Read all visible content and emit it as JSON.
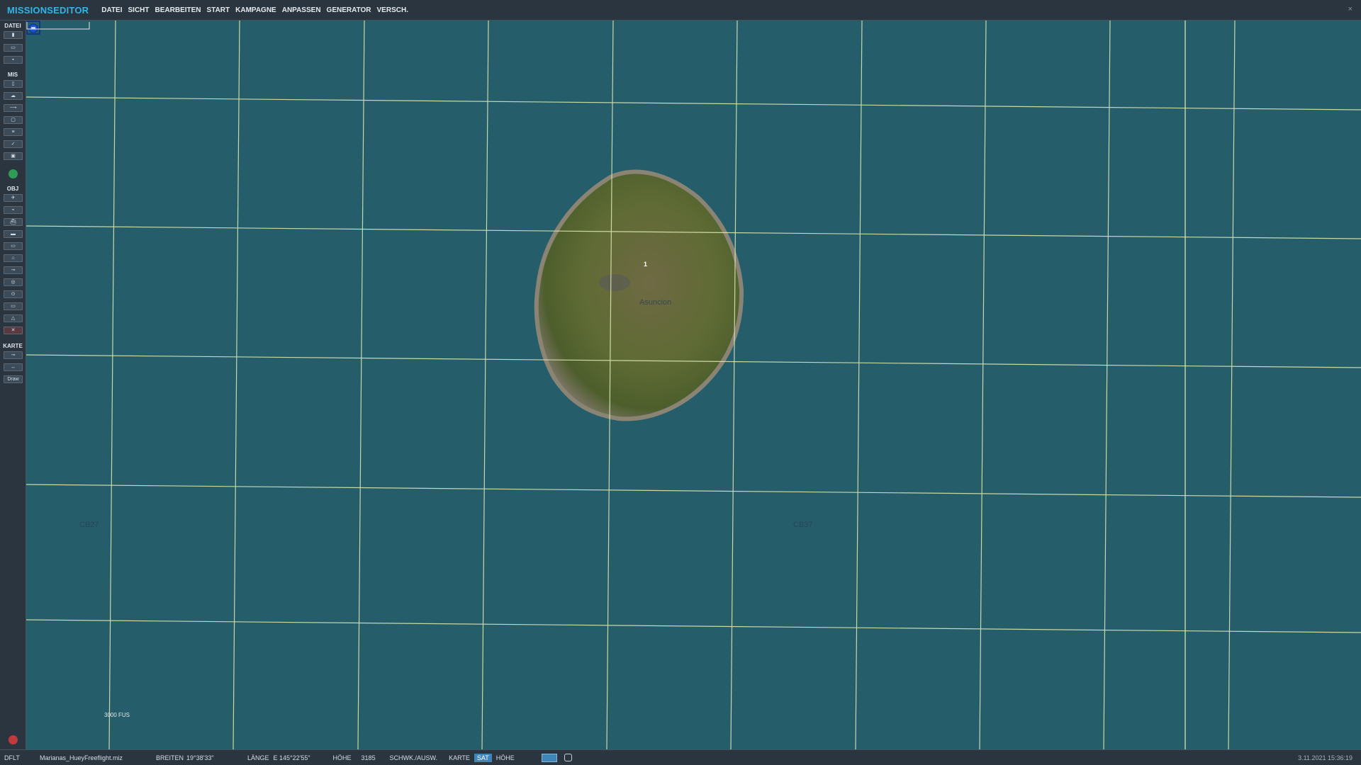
{
  "app": {
    "title": "MISSIONSEDITOR",
    "close_glyph": "×"
  },
  "menu": [
    "DATEI",
    "SICHT",
    "BEARBEITEN",
    "START",
    "KAMPAGNE",
    "ANPASSEN",
    "GENERATOR",
    "VERSCH."
  ],
  "sidebar": {
    "sections": {
      "file": "DATEI",
      "mission": "MIS",
      "objects": "OBJ",
      "map": "KARTE"
    },
    "draw_label": "Draw"
  },
  "map": {
    "island_name": "Asuncion",
    "unit_number": "1",
    "grid_labels": [
      "CB27",
      "CB37"
    ],
    "scale_label": "3000 FUS",
    "colors": {
      "sea": "#255d6b",
      "grid": "#d9e7b0",
      "unit": "#1d4fd8"
    }
  },
  "statusbar": {
    "preset": "DFLT",
    "filename": "Marianas_HueyFreeflight.miz",
    "lat_label": "BREITEN",
    "lat_value": "19°38'33\"",
    "lon_label": "LÄNGE",
    "lon_value": "E 145°22'55\"",
    "alt_label": "HÖHE",
    "alt_value": "3185",
    "select_label": "SCHWK./AUSW.",
    "mode_map": "KARTE",
    "mode_sat": "SAT",
    "mode_alt": "HÖHE",
    "datetime": "3.11.2021 15:36:19"
  }
}
